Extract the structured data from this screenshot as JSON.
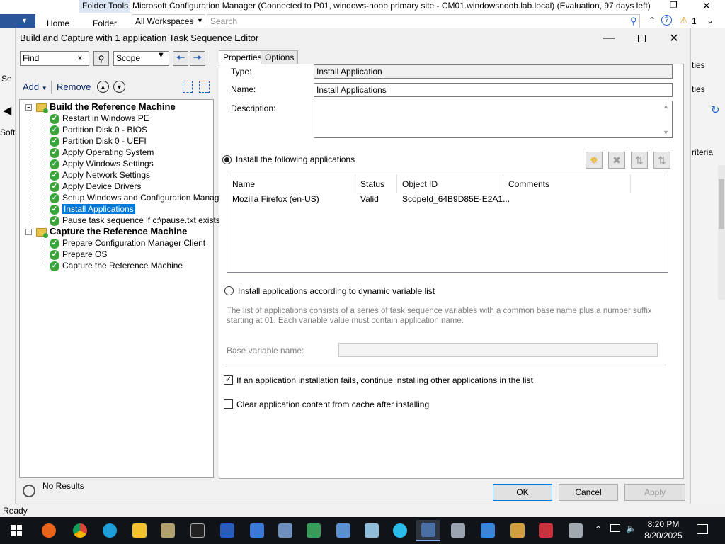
{
  "console": {
    "folder_tools": "Folder Tools",
    "title": "Microsoft Configuration Manager (Connected to P01, windows-noob primary site - CM01.windowsnoob.lab.local) (Evaluation, 97 days left)",
    "tab_home": "Home",
    "tab_folder": "Folder",
    "workspace": "All Workspaces",
    "search_placeholder": "Search",
    "notif_count": "1",
    "left_seq": "Se",
    "left_soft": "Soft",
    "right_ties1": "ties",
    "right_ties2": "ties",
    "right_criteria": "riteria",
    "status": "Ready"
  },
  "dialog": {
    "title": "Build and Capture with 1 application Task Sequence Editor",
    "find_value": "Find",
    "find_clear": "x",
    "scope_value": "Scope",
    "add_label": "Add",
    "remove_label": "Remove",
    "no_results": "No Results",
    "tree": {
      "groups": [
        {
          "label": "Build the Reference Machine",
          "items": [
            "Restart in Windows PE",
            "Partition Disk 0 - BIOS",
            "Partition Disk 0 - UEFI",
            "Apply Operating System",
            "Apply Windows Settings",
            "Apply Network Settings",
            "Apply Device Drivers",
            "Setup Windows and Configuration Manager",
            "Install Applications",
            "Pause task sequence if c:\\pause.txt exists"
          ]
        },
        {
          "label": "Capture the Reference Machine",
          "items": [
            "Prepare Configuration Manager Client",
            "Prepare OS",
            "Capture the Reference Machine"
          ]
        }
      ],
      "selected": "Install Applications"
    },
    "tabs": [
      "Properties",
      "Options"
    ],
    "props": {
      "type_label": "Type:",
      "type_value": "Install Application",
      "name_label": "Name:",
      "name_value": "Install Applications",
      "description_label": "Description:",
      "radio_following": "Install the following applications",
      "columns": [
        "Name",
        "Status",
        "Object ID",
        "Comments"
      ],
      "rows": [
        {
          "name": "Mozilla Firefox (en-US)",
          "status": "Valid",
          "object_id": "ScopeId_64B9D85E-E2A1...",
          "comments": ""
        }
      ],
      "radio_dynamic": "Install applications according to dynamic variable list",
      "dynamic_help": "The list of applications consists of a series of task sequence variables with a common base name plus a number suffix starting at 01. Each variable value must contain application name.",
      "base_var_label": "Base variable name:",
      "base_var_value": "",
      "continue_label": "If an application installation fails, continue installing other applications in the list",
      "continue_checked": true,
      "clear_cache_label": "Clear application content from cache after installing",
      "clear_cache_checked": false
    },
    "buttons": {
      "ok": "OK",
      "cancel": "Cancel",
      "apply": "Apply"
    }
  },
  "taskbar": {
    "time": "8:20 PM",
    "date": "8/20/2025"
  }
}
